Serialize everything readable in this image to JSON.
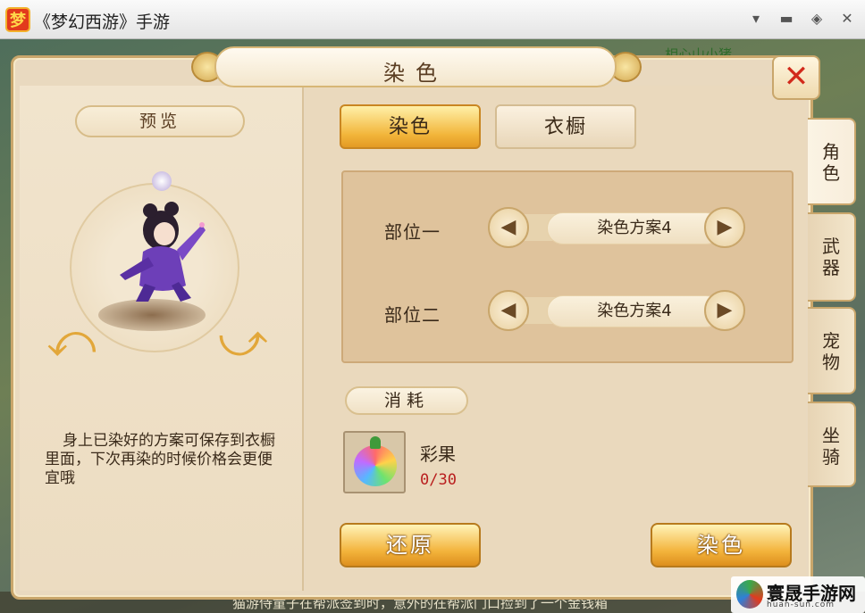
{
  "window": {
    "title": "《梦幻西游》手游",
    "icon": "梦",
    "controls": [
      "menu-icon",
      "minimize-icon",
      "restore-icon",
      "close-icon"
    ]
  },
  "background": {
    "top_text": "相心山小猪",
    "bottom_text": "猫游侍童子在帮派签到时，意外的在帮派门口捡到了一个金钱箱"
  },
  "panel": {
    "title": "染色",
    "close_label": "✕"
  },
  "left": {
    "preview_label": "预览",
    "description": "身上已染好的方案可保存到衣橱里面，下次再染的时候价格会更便宜哦"
  },
  "tabs": [
    {
      "label": "染色",
      "active": true
    },
    {
      "label": "衣橱",
      "active": false
    }
  ],
  "parts": [
    {
      "label": "部位一",
      "scheme": "染色方案4"
    },
    {
      "label": "部位二",
      "scheme": "染色方案4"
    }
  ],
  "cost": {
    "label": "消耗",
    "item_name": "彩果",
    "count": "0/30",
    "count_color": "#b91e1e"
  },
  "actions": {
    "reset_label": "还原",
    "dye_label": "染色"
  },
  "side_tabs": [
    {
      "label": "角色",
      "active": true
    },
    {
      "label": "武器",
      "active": false
    },
    {
      "label": "宠物",
      "active": false
    },
    {
      "label": "坐骑",
      "active": false
    }
  ],
  "watermark": {
    "text": "寰晟手游网",
    "sub": "huan-sun.com"
  },
  "colors": {
    "accent": "#f2b53a",
    "panel_bg": "#e9d9bf",
    "close_red": "#d22a1b"
  }
}
